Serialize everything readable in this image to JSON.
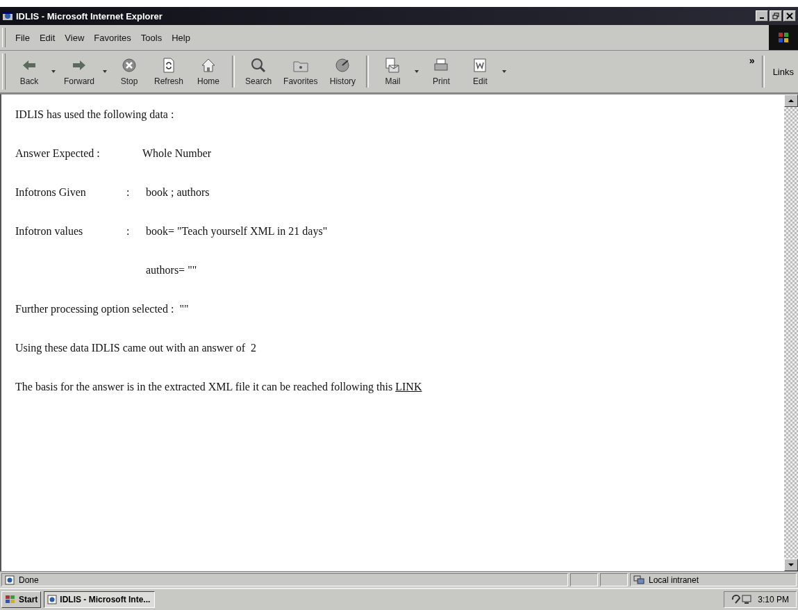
{
  "window": {
    "title": "IDLIS - Microsoft Internet Explorer"
  },
  "menu": [
    "File",
    "Edit",
    "View",
    "Favorites",
    "Tools",
    "Help"
  ],
  "toolbar": [
    {
      "label": "Back",
      "dropdown": true
    },
    {
      "label": "Forward",
      "dropdown": true
    },
    {
      "label": "Stop",
      "dropdown": false
    },
    {
      "label": "Refresh",
      "dropdown": false
    },
    {
      "label": "Home",
      "dropdown": false
    },
    {
      "label": "Search",
      "dropdown": false
    },
    {
      "label": "Favorites",
      "dropdown": false
    },
    {
      "label": "History",
      "dropdown": false
    },
    {
      "label": "Mail",
      "dropdown": true
    },
    {
      "label": "Print",
      "dropdown": false
    },
    {
      "label": "Edit",
      "dropdown": true
    }
  ],
  "more": "»",
  "links": "Links",
  "content": [
    {
      "kind": "text",
      "text": "IDLIS has used the following data :"
    },
    {
      "kind": "field",
      "label": "Answer Expected :",
      "value": "Whole Number"
    },
    {
      "kind": "field",
      "label": "Infotrons Given",
      "separator": ":",
      "value": "book ; authors"
    },
    {
      "kind": "field",
      "label": "Infotron values",
      "separator": ":",
      "value": "book= \"Teach yourself XML in 21 days\""
    },
    {
      "kind": "field",
      "value": "authors= \"\""
    },
    {
      "kind": "text",
      "text": "Further processing option selected :  \"\""
    },
    {
      "kind": "text",
      "text": "Using these data IDLIS came out with an answer of  2"
    },
    {
      "kind": "link",
      "text": "The basis for the answer is in the extracted XML file it can be reached following this",
      "link": "LINK"
    }
  ],
  "status_bar": {
    "text": "Done",
    "zone": "Local intranet"
  },
  "taskbar": {
    "start": "Start",
    "task": "IDLIS - Microsoft Inte...",
    "clock": "3:10 PM"
  }
}
